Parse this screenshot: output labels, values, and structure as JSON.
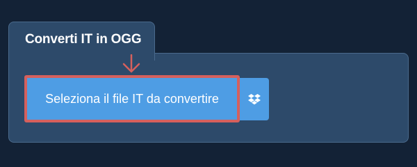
{
  "converter": {
    "tab_title": "Converti IT in OGG",
    "select_button_label": "Seleziona il file IT da convertire",
    "dropbox_icon": "dropbox-icon",
    "highlight_arrow_icon": "arrow-down-icon"
  },
  "colors": {
    "page_background": "#132236",
    "panel_background": "#2d4a6a",
    "button_blue": "#4e9de4",
    "highlight_red": "#d5605d"
  }
}
